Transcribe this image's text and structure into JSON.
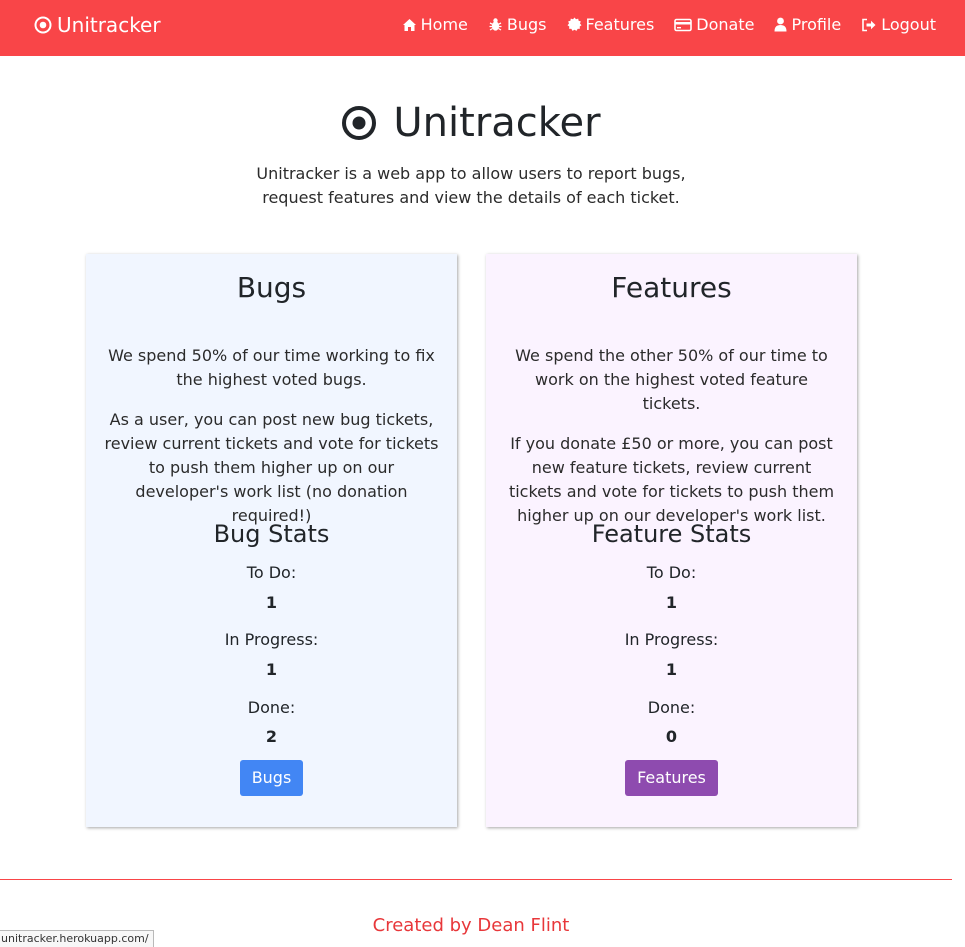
{
  "navbar": {
    "brand": "Unitracker",
    "brand_icon": "bullseye-icon",
    "links": [
      {
        "label": "Home",
        "icon": "home-icon"
      },
      {
        "label": "Bugs",
        "icon": "bug-icon"
      },
      {
        "label": "Features",
        "icon": "certificate-icon"
      },
      {
        "label": "Donate",
        "icon": "credit-card-icon"
      },
      {
        "label": "Profile",
        "icon": "user-icon"
      },
      {
        "label": "Logout",
        "icon": "sign-out-icon"
      }
    ],
    "color": "#f94548"
  },
  "hero": {
    "title": "Unitracker",
    "description_line1": "Unitracker is a web app to allow users to report bugs,",
    "description_line2": "request features and view the details of each ticket."
  },
  "bugs_card": {
    "heading": "Bugs",
    "paragraph1": "We spend 50% of our time working to fix the highest voted bugs.",
    "paragraph2": "As a user, you can post new bug tickets, review current tickets and vote for tickets to push them higher up on our developer's work list (no donation required!)",
    "stats_heading": "Bug Stats",
    "todo_label": "To Do:",
    "todo_value": "1",
    "inprogress_label": "In Progress:",
    "inprogress_value": "1",
    "done_label": "Done:",
    "done_value": "2",
    "button_label": "Bugs",
    "background": "#f1f6ff",
    "button_color": "#4286f4"
  },
  "features_card": {
    "heading": "Features",
    "paragraph1": "We spend the other 50% of our time to work on the highest voted feature tickets.",
    "paragraph2": "If you donate £50 or more, you can post new feature tickets, review current tickets and vote for tickets to push them higher up on our developer's work list.",
    "stats_heading": "Feature Stats",
    "todo_label": "To Do:",
    "todo_value": "1",
    "inprogress_label": "In Progress:",
    "inprogress_value": "1",
    "done_label": "Done:",
    "done_value": "0",
    "button_label": "Features",
    "background": "#fbf3ff",
    "button_color": "#8e4baf"
  },
  "footer": {
    "text": "Created by Dean Flint"
  },
  "status_bar": {
    "url": "unitracker.herokuapp.com/"
  }
}
